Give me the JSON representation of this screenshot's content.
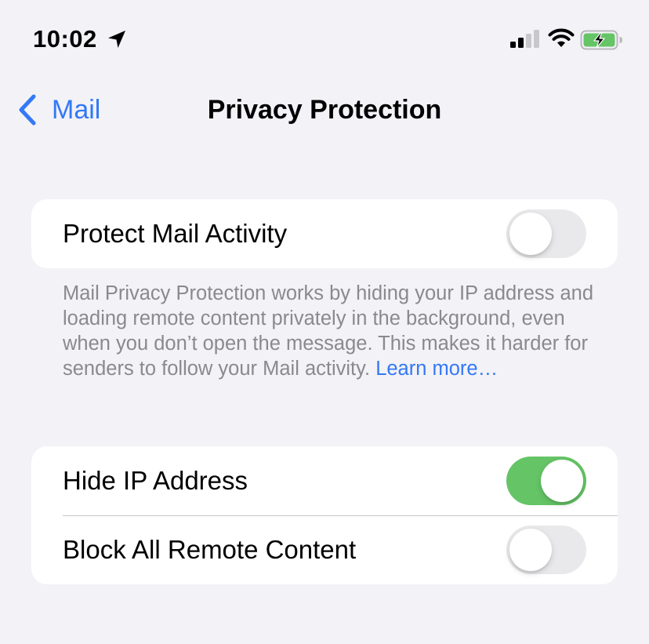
{
  "status_bar": {
    "time": "10:02",
    "icons": [
      "location-arrow-icon",
      "cellular-signal-icon",
      "wifi-icon",
      "battery-charging-icon"
    ],
    "battery_color": "#65c466"
  },
  "nav": {
    "back_label": "Mail",
    "title": "Privacy Protection"
  },
  "colors": {
    "accent": "#3478f6",
    "toggle_on": "#65c466",
    "toggle_off": "#e9e9eb",
    "background": "#f2f2f7"
  },
  "settings": {
    "protect_mail_activity": {
      "label": "Protect Mail Activity",
      "enabled": false
    },
    "footer": {
      "text": "Mail Privacy Protection works by hiding your IP address and loading remote content privately in the background, even when you don’t open the message. This makes it harder for senders to follow your Mail activity.",
      "link": "Learn more…"
    },
    "hide_ip_address": {
      "label": "Hide IP Address",
      "enabled": true
    },
    "block_remote_content": {
      "label": "Block All Remote Content",
      "enabled": false
    }
  }
}
